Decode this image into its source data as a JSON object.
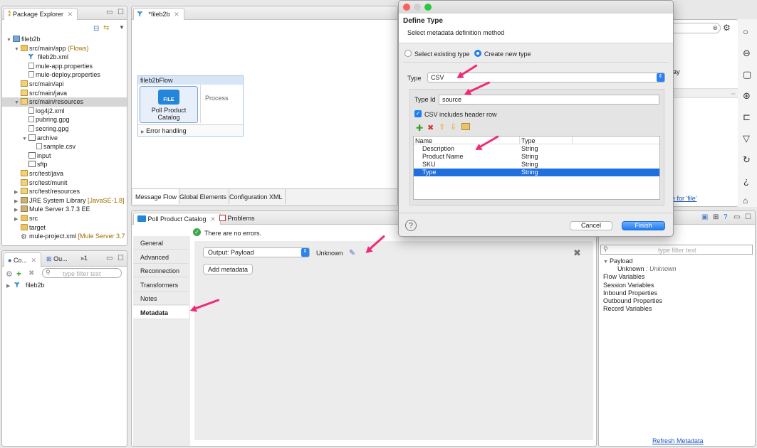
{
  "package_explorer": {
    "tab_label": "Package Explorer",
    "tree": [
      {
        "label": "fileb2b",
        "indent": 0,
        "twisty": "▼",
        "icon": "proj"
      },
      {
        "label": "src/main/app",
        "decoration": " (Flows)",
        "indent": 1,
        "twisty": "▼",
        "icon": "folder"
      },
      {
        "label": "fileb2b.xml",
        "indent": 2,
        "twisty": "",
        "icon": "mule"
      },
      {
        "label": "mule-app.properties",
        "indent": 2,
        "twisty": "",
        "icon": "file"
      },
      {
        "label": "mule-deploy.properties",
        "indent": 2,
        "twisty": "",
        "icon": "file"
      },
      {
        "label": "src/main/api",
        "indent": 1,
        "twisty": "",
        "icon": "pkg"
      },
      {
        "label": "src/main/java",
        "indent": 1,
        "twisty": "",
        "icon": "pkg"
      },
      {
        "label": "src/main/resources",
        "indent": 1,
        "twisty": "▼",
        "icon": "pkg",
        "selected": true
      },
      {
        "label": "log4j2.xml",
        "indent": 2,
        "twisty": "",
        "icon": "xml"
      },
      {
        "label": "pubring.gpg",
        "indent": 2,
        "twisty": "",
        "icon": "file"
      },
      {
        "label": "secring.gpg",
        "indent": 2,
        "twisty": "",
        "icon": "file"
      },
      {
        "label": "archive",
        "indent": 2,
        "twisty": "▼",
        "icon": "grid"
      },
      {
        "label": "sample.csv",
        "indent": 3,
        "twisty": "",
        "icon": "file"
      },
      {
        "label": "input",
        "indent": 2,
        "twisty": "",
        "icon": "grid"
      },
      {
        "label": "sftp",
        "indent": 2,
        "twisty": "",
        "icon": "grid"
      },
      {
        "label": "src/test/java",
        "indent": 1,
        "twisty": "",
        "icon": "pkg"
      },
      {
        "label": "src/test/munit",
        "indent": 1,
        "twisty": "",
        "icon": "pkg"
      },
      {
        "label": "src/test/resources",
        "indent": 1,
        "twisty": "▶",
        "icon": "pkg"
      },
      {
        "label": "JRE System Library",
        "decoration": " [JavaSE-1.8]",
        "indent": 1,
        "twisty": "▶",
        "icon": "lib"
      },
      {
        "label": "Mule Server 3.7.3 EE",
        "indent": 1,
        "twisty": "▶",
        "icon": "lib"
      },
      {
        "label": "src",
        "indent": 1,
        "twisty": "▶",
        "icon": "folder"
      },
      {
        "label": "target",
        "indent": 1,
        "twisty": "",
        "icon": "folder"
      },
      {
        "label": "mule-project.xml",
        "decoration": " [Mule Server 3.7",
        "indent": 1,
        "twisty": "",
        "icon": "gear"
      }
    ]
  },
  "outline": {
    "tab1": "Co...",
    "tab2": "Ou...",
    "tab_more": "»1",
    "filter_placeholder": "type filter text",
    "tree_item": "fileb2b"
  },
  "editor": {
    "tab_label": "*fileb2b",
    "flow_name": "fileb2bFlow",
    "component_label": "Poll Product Catalog",
    "component_badge": "FILE",
    "process_label": "Process",
    "error_handling": "Error handling",
    "bottom_tabs": [
      "Message Flow",
      "Global Elements",
      "Configuration XML"
    ]
  },
  "properties": {
    "tab_label": "Poll Product Catalog",
    "problems_tab": "Problems",
    "status": "There are no errors.",
    "sections": [
      "General",
      "Advanced",
      "Reconnection",
      "Transformers",
      "Notes",
      "Metadata"
    ],
    "selected_section": "Metadata",
    "output_select": "Output: Payload",
    "unknown_label": "Unknown",
    "add_metadata": "Add metadata"
  },
  "right_panel": {
    "filter_placeholder": "type filter text",
    "tree": [
      {
        "label": "Payload",
        "indent": 0,
        "twisty": "▼"
      },
      {
        "label": "Unknown",
        "suffix": " : Unknown",
        "indent": 1,
        "twisty": ""
      },
      {
        "label": "Flow Variables",
        "indent": 0,
        "twisty": ""
      },
      {
        "label": "Session Variables",
        "indent": 0,
        "twisty": ""
      },
      {
        "label": "Inbound Properties",
        "indent": 0,
        "twisty": ""
      },
      {
        "label": "Outbound Properties",
        "indent": 0,
        "twisty": ""
      },
      {
        "label": "Record Variables",
        "indent": 0,
        "twisty": ""
      }
    ],
    "refresh_link": "Refresh Metadata",
    "partial_text_1": "ay",
    "partial_link": "e for 'file'"
  },
  "dialog": {
    "title": "Define Type",
    "subtitle": "Select metadata definition method",
    "radio_existing": "Select existing type",
    "radio_new": "Create new type",
    "type_label": "Type",
    "type_value": "CSV",
    "type_id_label": "Type Id",
    "type_id_value": "source",
    "checkbox_label": "CSV includes header row",
    "table_headers": [
      "Name",
      "Type"
    ],
    "table_rows": [
      {
        "name": "Description",
        "type": "String"
      },
      {
        "name": "Product Name",
        "type": "String"
      },
      {
        "name": "SKU",
        "type": "String"
      },
      {
        "name": "Type",
        "type": "String",
        "selected": true
      }
    ],
    "cancel": "Cancel",
    "finish": "Finish"
  },
  "colors": {
    "accent": "#1b7ff2",
    "selection": "#1e6fe0",
    "annotation_arrow": "#f02a78",
    "link": "#1a55b5"
  }
}
